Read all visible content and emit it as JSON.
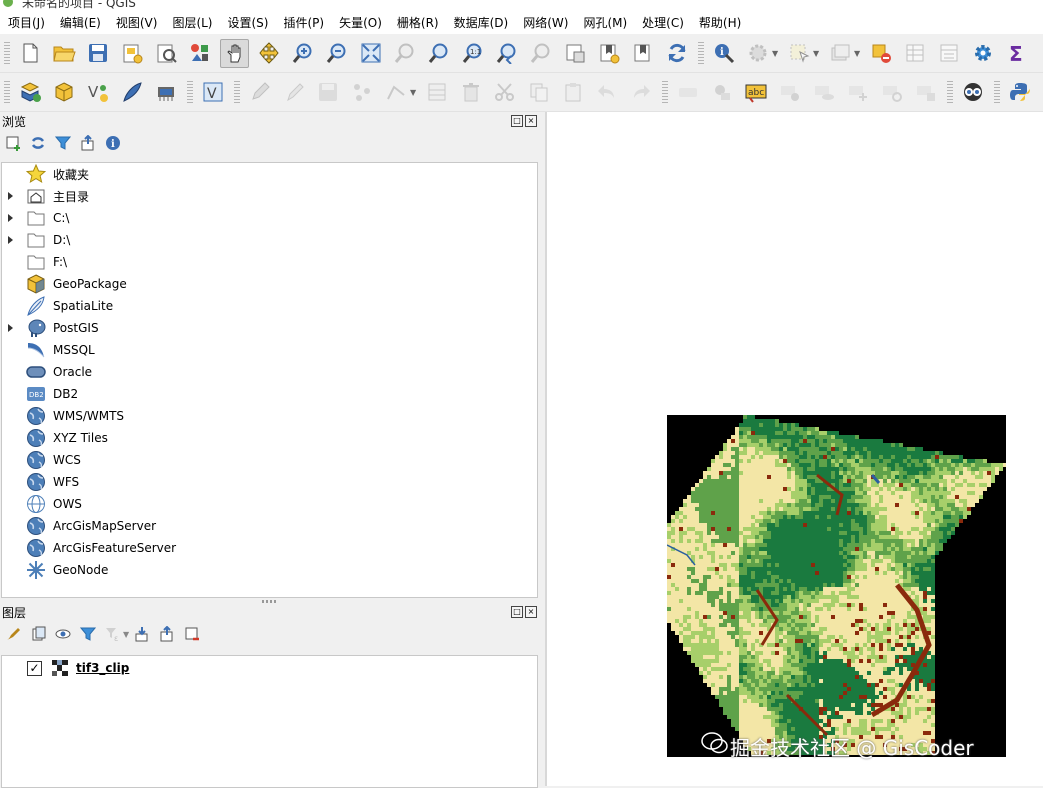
{
  "window": {
    "title": "未命名的项目 - QGIS"
  },
  "menu": [
    "项目(J)",
    "编辑(E)",
    "视图(V)",
    "图层(L)",
    "设置(S)",
    "插件(P)",
    "矢量(O)",
    "栅格(R)",
    "数据库(D)",
    "网络(W)",
    "网孔(M)",
    "处理(C)",
    "帮助(H)"
  ],
  "browser": {
    "title": "浏览",
    "items": [
      {
        "label": "收藏夹",
        "icon": "star-icon",
        "expandable": false
      },
      {
        "label": "主目录",
        "icon": "home-folder-icon",
        "expandable": true
      },
      {
        "label": "C:\\",
        "icon": "folder-icon",
        "expandable": true
      },
      {
        "label": "D:\\",
        "icon": "folder-icon",
        "expandable": true
      },
      {
        "label": "F:\\",
        "icon": "folder-icon",
        "expandable": false
      },
      {
        "label": "GeoPackage",
        "icon": "geopackage-icon",
        "expandable": false
      },
      {
        "label": "SpatiaLite",
        "icon": "spatialite-feather-icon",
        "expandable": false
      },
      {
        "label": "PostGIS",
        "icon": "postgis-elephant-icon",
        "expandable": true
      },
      {
        "label": "MSSQL",
        "icon": "mssql-icon",
        "expandable": false
      },
      {
        "label": "Oracle",
        "icon": "oracle-icon",
        "expandable": false
      },
      {
        "label": "DB2",
        "icon": "db2-icon",
        "expandable": false
      },
      {
        "label": "WMS/WMTS",
        "icon": "globe-icon",
        "expandable": false
      },
      {
        "label": "XYZ Tiles",
        "icon": "globe-icon",
        "expandable": false
      },
      {
        "label": "WCS",
        "icon": "globe-icon",
        "expandable": false
      },
      {
        "label": "WFS",
        "icon": "globe-icon",
        "expandable": false
      },
      {
        "label": "OWS",
        "icon": "globe-outline-icon",
        "expandable": false
      },
      {
        "label": "ArcGisMapServer",
        "icon": "globe-icon",
        "expandable": false
      },
      {
        "label": "ArcGisFeatureServer",
        "icon": "globe-icon",
        "expandable": false
      },
      {
        "label": "GeoNode",
        "icon": "geonode-icon",
        "expandable": false
      }
    ],
    "db2_badge": "DB2"
  },
  "layers": {
    "title": "图层",
    "items": [
      {
        "label": "tif3_clip",
        "checked": true
      }
    ]
  },
  "watermark": "掘金技术社区 @ GisCoder",
  "colors": {
    "dark_green": "#1a7a3f",
    "mid_green": "#5fa24a",
    "light_green": "#a7cf6a",
    "cream": "#f3e6a6",
    "brown": "#8a2a0c",
    "water": "#2b5fa0"
  }
}
